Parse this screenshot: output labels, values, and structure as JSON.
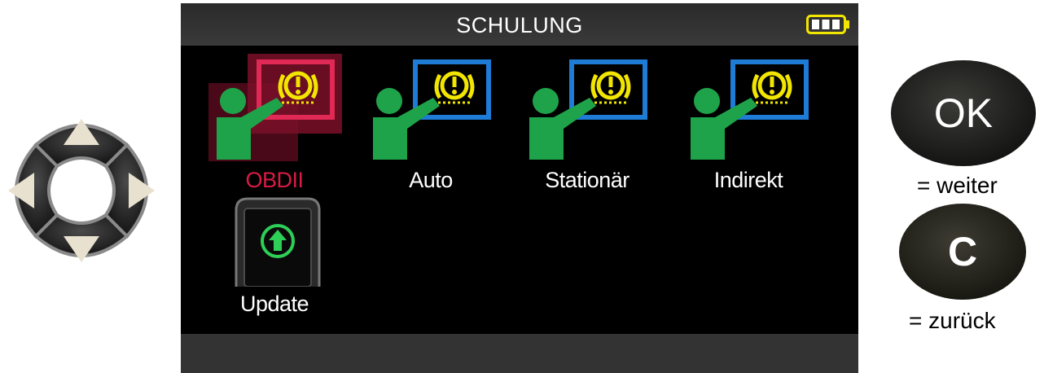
{
  "screen": {
    "title": "SCHULUNG",
    "battery_icon": "battery-full-icon"
  },
  "menu": {
    "items": [
      {
        "label": "OBDII",
        "icon": "training-warning-icon",
        "selected": true
      },
      {
        "label": "Auto",
        "icon": "training-warning-icon",
        "selected": false
      },
      {
        "label": "Stationär",
        "icon": "training-warning-icon",
        "selected": false
      },
      {
        "label": "Indirekt",
        "icon": "training-warning-icon",
        "selected": false
      },
      {
        "label": "Update",
        "icon": "update-device-icon",
        "selected": false
      }
    ]
  },
  "controls": {
    "ok_key": "OK",
    "ok_caption": "= weiter",
    "c_key": "C",
    "c_caption": "= zurück",
    "dpad_icon": "direction-pad-icon"
  },
  "colors": {
    "selected": "#d81b44",
    "person": "#1fa34a",
    "board": "#1e7bd6",
    "warning": "#f2e600"
  }
}
